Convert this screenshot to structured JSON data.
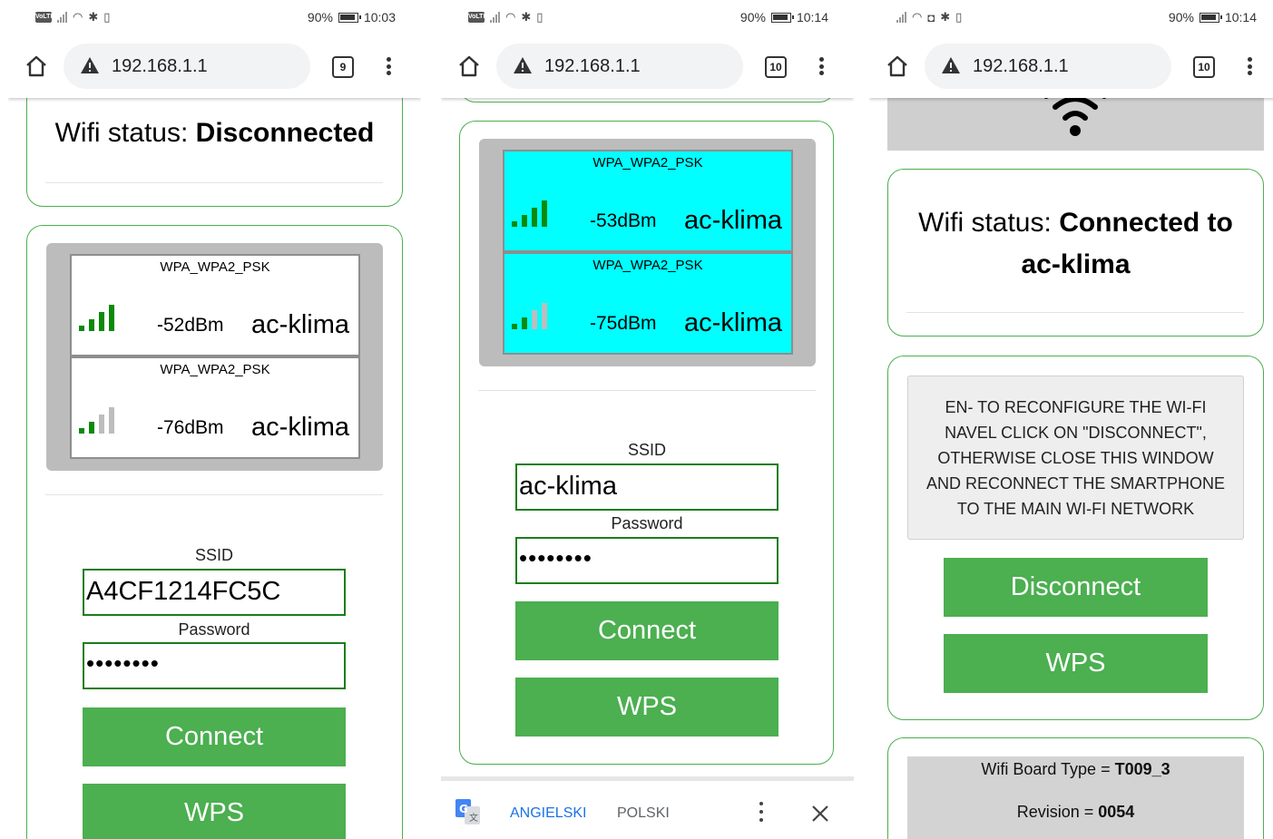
{
  "phones": [
    {
      "status": {
        "battery": "90%",
        "time": "10:03"
      },
      "browser": {
        "url": "192.168.1.1",
        "tabs": "9"
      },
      "wifi_status": {
        "label": "Wifi status:",
        "value": "Disconnected"
      },
      "networks": [
        {
          "security": "WPA_WPA2_PSK",
          "rssi": "-52dBm",
          "ssid": "ac-klima",
          "signal_bars": 4
        },
        {
          "security": "WPA_WPA2_PSK",
          "rssi": "-76dBm",
          "ssid": "ac-klima",
          "signal_bars": 2
        }
      ],
      "form": {
        "ssid_label": "SSID",
        "ssid_value": "A4CF1214FC5C",
        "password_label": "Password",
        "password_value": "••••••••",
        "connect": "Connect",
        "wps": "WPS"
      }
    },
    {
      "status": {
        "battery": "90%",
        "time": "10:14"
      },
      "browser": {
        "url": "192.168.1.1",
        "tabs": "10"
      },
      "networks": [
        {
          "security": "WPA_WPA2_PSK",
          "rssi": "-53dBm",
          "ssid": "ac-klima",
          "signal_bars": 4
        },
        {
          "security": "WPA_WPA2_PSK",
          "rssi": "-75dBm",
          "ssid": "ac-klima",
          "signal_bars": 2
        }
      ],
      "form": {
        "ssid_label": "SSID",
        "ssid_value": "ac-klima",
        "password_label": "Password",
        "password_value": "••••••••",
        "connect": "Connect",
        "wps": "WPS"
      },
      "translate": {
        "source": "ANGIELSKI",
        "target": "POLSKI"
      }
    },
    {
      "status": {
        "battery": "90%",
        "time": "10:14"
      },
      "browser": {
        "url": "192.168.1.1",
        "tabs": "10"
      },
      "wifi_status": {
        "label": "Wifi status:",
        "value_line1": "Connected to",
        "value_line2": "ac-klima"
      },
      "info": {
        "line1": "EN- TO RECONFIGURE THE WI-FI",
        "line2": "NAVEL CLICK ON \"DISCONNECT\",",
        "line3": "OTHERWISE CLOSE THIS WINDOW",
        "line4": "AND RECONNECT THE SMARTPHONE",
        "line5": "TO THE MAIN WI-FI NETWORK"
      },
      "buttons": {
        "disconnect": "Disconnect",
        "wps": "WPS"
      },
      "board": {
        "type_label": "Wifi Board Type = ",
        "type_value": "T009_3",
        "revision_label": "Revision = ",
        "revision_value": "0054"
      }
    }
  ],
  "colors": {
    "accent_green": "#4CAF50",
    "input_border": "#1a7d1a",
    "selected_network": "#00ffff",
    "signal_active": "#0a8a0a",
    "signal_inactive": "#bdbdbd"
  },
  "icons": [
    "home-icon",
    "warning-icon",
    "tab-counter-icon",
    "overflow-menu-icon",
    "wifi-icon",
    "google-translate-icon",
    "close-icon",
    "battery-icon",
    "signal-icon"
  ]
}
